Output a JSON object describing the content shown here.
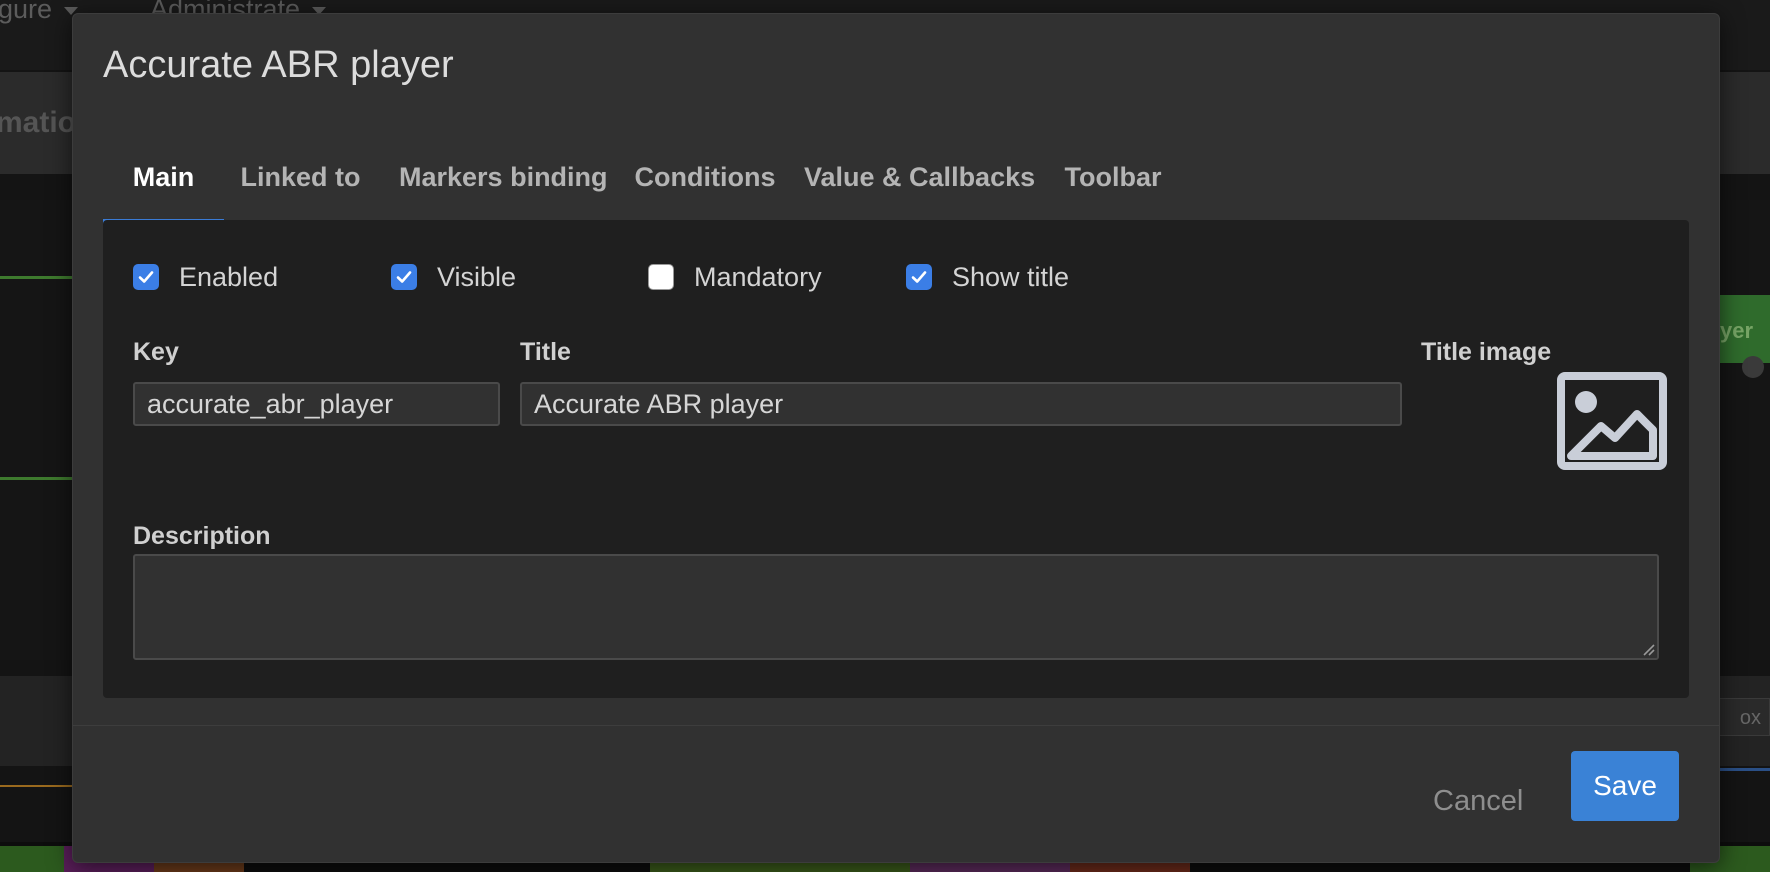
{
  "background": {
    "menu_items": [
      "gure",
      "Administrate"
    ],
    "band_text": "matio",
    "right_chip_text": "yer",
    "right_button_text": "ox"
  },
  "modal": {
    "title": "Accurate ABR player",
    "tabs": [
      {
        "label": "Main",
        "active": true
      },
      {
        "label": "Linked to",
        "active": false
      },
      {
        "label": "Markers binding",
        "active": false
      },
      {
        "label": "Conditions",
        "active": false
      },
      {
        "label": "Value & Callbacks",
        "active": false
      },
      {
        "label": "Toolbar",
        "active": false
      }
    ],
    "checkboxes": [
      {
        "label": "Enabled",
        "checked": true
      },
      {
        "label": "Visible",
        "checked": true
      },
      {
        "label": "Mandatory",
        "checked": false
      },
      {
        "label": "Show title",
        "checked": true
      }
    ],
    "fields": {
      "key_label": "Key",
      "key_value": "accurate_abr_player",
      "title_label": "Title",
      "title_value": "Accurate ABR player",
      "title_image_label": "Title image",
      "title_image_icon": "image-placeholder-icon",
      "description_label": "Description",
      "description_value": ""
    },
    "footer": {
      "cancel_label": "Cancel",
      "save_label": "Save"
    }
  },
  "colors": {
    "accent": "#3a7bd5",
    "checkbox_on": "#3b7ee6",
    "save_button": "#3a82d6"
  }
}
